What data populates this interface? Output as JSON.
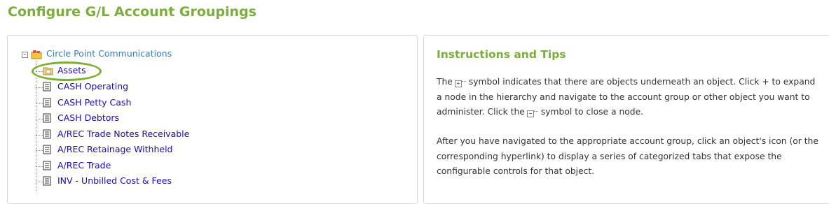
{
  "page": {
    "title": "Configure G/L Account Groupings"
  },
  "tree": {
    "root_label": "Circle Point Communications",
    "selected_label": "Assets",
    "items": [
      {
        "label": "CASH Operating"
      },
      {
        "label": "CASH Petty Cash"
      },
      {
        "label": "CASH Debtors"
      },
      {
        "label": "A/REC Trade Notes Receivable"
      },
      {
        "label": "A/REC Retainage Withheld"
      },
      {
        "label": "A/REC Trade"
      },
      {
        "label": "INV - Unbilled Cost & Fees"
      }
    ]
  },
  "instructions": {
    "title": "Instructions and Tips",
    "p1_a": "The",
    "p1_b": "symbol indicates that there are objects underneath an object. Click + to expand a node in the hierarchy and navigate to the account group or other object you want to administer. Click the",
    "p1_c": "symbol to close a node.",
    "p2": "After you have navigated to the appropriate account group, click an object's icon (or the corresponding hyperlink) to display a series of categorized tabs that expose the configurable controls for that object."
  },
  "colors": {
    "accent_green": "#7aad3a",
    "link_blue": "#1a0dab",
    "root_link_blue": "#3a7ab8",
    "highlight_ring": "#7ab02f"
  },
  "icons": [
    "expand-icon",
    "collapse-icon",
    "company-icon",
    "folder-icon",
    "document-icon"
  ]
}
